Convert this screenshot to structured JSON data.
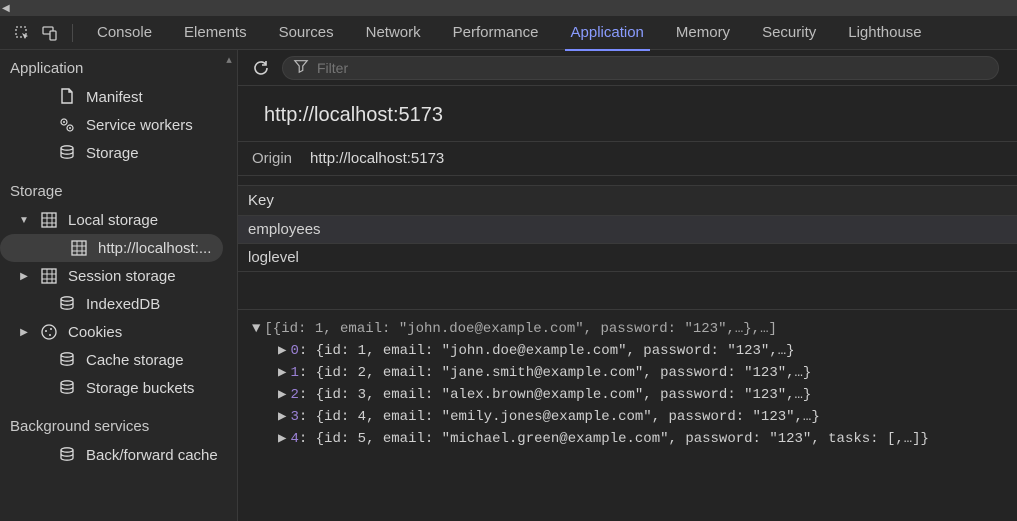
{
  "tabs": {
    "items": [
      "Console",
      "Elements",
      "Sources",
      "Network",
      "Performance",
      "Application",
      "Memory",
      "Security",
      "Lighthouse"
    ],
    "activeIndex": 5
  },
  "sidebar": {
    "groups": [
      {
        "title": "Application",
        "items": [
          {
            "icon": "file",
            "label": "Manifest"
          },
          {
            "icon": "gears",
            "label": "Service workers"
          },
          {
            "icon": "db",
            "label": "Storage"
          }
        ]
      },
      {
        "title": "Storage",
        "items": [
          {
            "arrow": "down",
            "icon": "grid",
            "label": "Local storage",
            "children": [
              {
                "icon": "grid",
                "label": "http://localhost:...",
                "selected": true
              }
            ]
          },
          {
            "arrow": "right",
            "icon": "grid",
            "label": "Session storage"
          },
          {
            "icon": "db",
            "label": "IndexedDB"
          },
          {
            "arrow": "right",
            "icon": "cookie",
            "label": "Cookies"
          },
          {
            "icon": "db",
            "label": "Cache storage"
          },
          {
            "icon": "db",
            "label": "Storage buckets"
          }
        ]
      },
      {
        "title": "Background services",
        "items": [
          {
            "icon": "db",
            "label": "Back/forward cache"
          }
        ]
      }
    ]
  },
  "toolbar": {
    "filter_placeholder": "Filter"
  },
  "origin": {
    "title": "http://localhost:5173",
    "label": "Origin",
    "value": "http://localhost:5173"
  },
  "kv": {
    "header": "Key",
    "rows": [
      {
        "key": "employees",
        "selected": true
      },
      {
        "key": "loglevel"
      }
    ]
  },
  "detail": {
    "top": "[{id: 1, email: \"john.doe@example.com\", password: \"123\",…},…]",
    "rows": [
      {
        "idx": "0",
        "text": "{id: 1, email: \"john.doe@example.com\", password: \"123\",…}"
      },
      {
        "idx": "1",
        "text": "{id: 2, email: \"jane.smith@example.com\", password: \"123\",…}"
      },
      {
        "idx": "2",
        "text": "{id: 3, email: \"alex.brown@example.com\", password: \"123\",…}"
      },
      {
        "idx": "3",
        "text": "{id: 4, email: \"emily.jones@example.com\", password: \"123\",…}"
      },
      {
        "idx": "4",
        "text": "{id: 5, email: \"michael.green@example.com\", password: \"123\", tasks: [,…]}"
      }
    ]
  }
}
